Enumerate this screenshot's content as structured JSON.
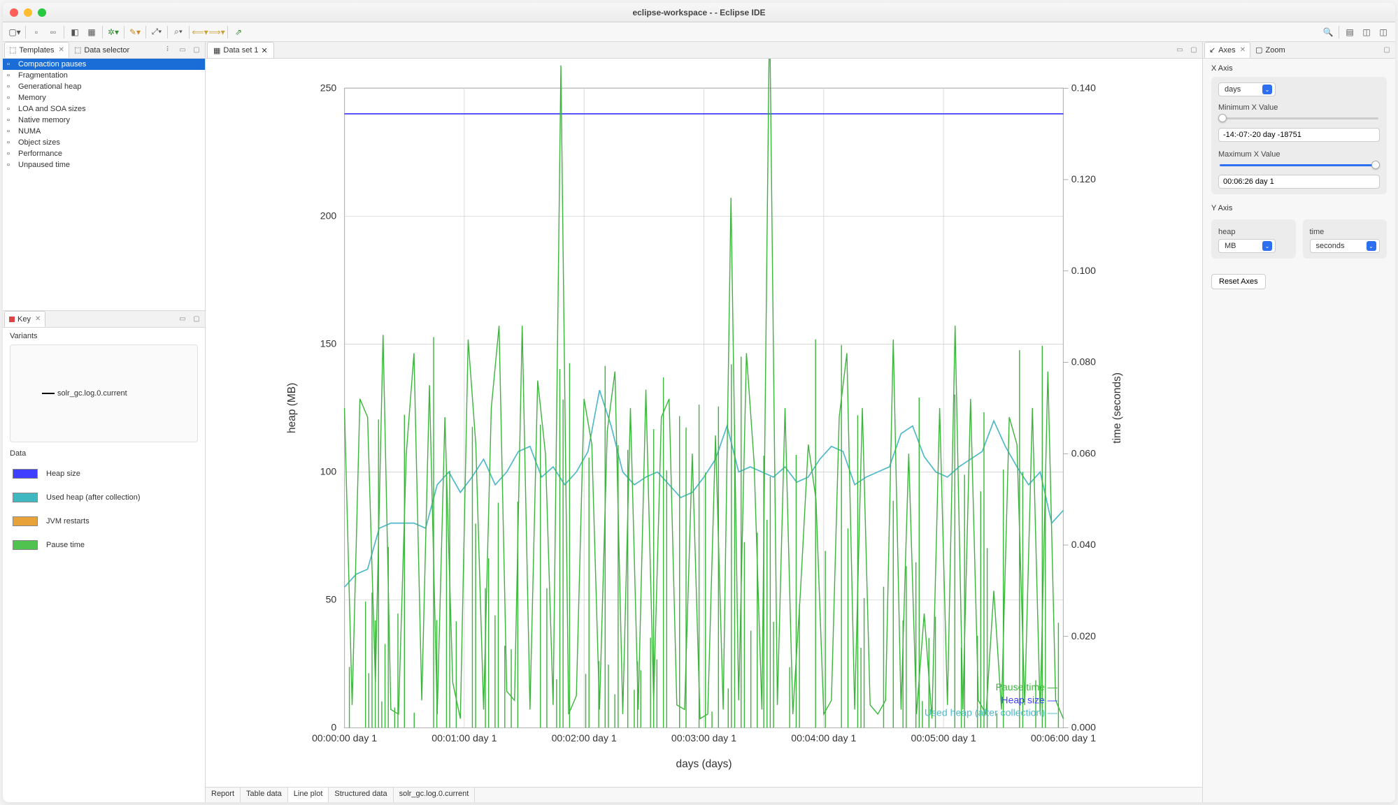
{
  "window": {
    "title": "eclipse-workspace -  - Eclipse IDE"
  },
  "left": {
    "tabs": {
      "templates": "Templates",
      "data_selector": "Data selector"
    },
    "tree_items": [
      "Compaction pauses",
      "Fragmentation",
      "Generational heap",
      "Memory",
      "LOA and SOA sizes",
      "Native memory",
      "NUMA",
      "Object sizes",
      "Performance",
      "Unpaused time"
    ],
    "key_tab": "Key",
    "variants_label": "Variants",
    "variants_item": "solr_gc.log.0.current",
    "data_label": "Data",
    "data_items": [
      {
        "label": "Heap size",
        "color": "#3f3fff"
      },
      {
        "label": "Used heap (after collection)",
        "color": "#3fb8bf"
      },
      {
        "label": "JVM restarts",
        "color": "#e8a23a"
      },
      {
        "label": "Pause time",
        "color": "#4fc24f"
      }
    ]
  },
  "center": {
    "editor_tab": "Data set 1",
    "bottom_tabs": [
      "Report",
      "Table data",
      "Line plot",
      "Structured data",
      "solr_gc.log.0.current"
    ],
    "active_bottom": 2
  },
  "right": {
    "tabs": {
      "axes": "Axes",
      "zoom": "Zoom"
    },
    "x_axis_label": "X Axis",
    "x_unit": "days",
    "min_x_label": "Minimum X Value",
    "min_x_value": "-14:-07:-20 day -18751",
    "max_x_label": "Maximum X Value",
    "max_x_value": "00:06:26 day 1",
    "y_axis_label": "Y Axis",
    "y_heap_label": "heap",
    "y_heap_unit": "MB",
    "y_time_label": "time",
    "y_time_unit": "seconds",
    "reset_btn": "Reset Axes"
  },
  "chart_data": {
    "type": "line",
    "xlabel": "days (days)",
    "ylabel_left": "heap (MB)",
    "ylabel_right": "time (seconds)",
    "x_ticks": [
      "00:00:00 day 1",
      "00:01:00 day 1",
      "00:02:00 day 1",
      "00:03:00 day 1",
      "00:04:00 day 1",
      "00:05:00 day 1",
      "00:06:00 day 1"
    ],
    "y_left_ticks": [
      0,
      50,
      100,
      150,
      200,
      250
    ],
    "y_right_ticks": [
      0.0,
      0.02,
      0.04,
      0.06,
      0.08,
      0.1,
      0.12,
      0.14
    ],
    "heap_size_mb": 240,
    "legend": [
      "Pause time",
      "Heap size",
      "Used heap (after collection)"
    ],
    "series": [
      {
        "name": "Used heap (after collection)",
        "color": "#4fb8c9",
        "axis": "left",
        "y": [
          55,
          60,
          62,
          78,
          80,
          80,
          80,
          78,
          95,
          100,
          92,
          98,
          105,
          95,
          100,
          108,
          110,
          98,
          102,
          95,
          100,
          108,
          132,
          118,
          100,
          95,
          98,
          100,
          95,
          90,
          92,
          98,
          105,
          118,
          100,
          102,
          100,
          98,
          102,
          96,
          98,
          105,
          110,
          108,
          95,
          98,
          100,
          102,
          115,
          118,
          106,
          100,
          98,
          102,
          105,
          108,
          120,
          110,
          102,
          95,
          100,
          80,
          85
        ]
      },
      {
        "name": "Pause time",
        "color": "#3bb53b",
        "axis": "right",
        "y": [
          0.07,
          0.005,
          0.072,
          0.068,
          0.01,
          0.086,
          0.004,
          0.003,
          0.06,
          0.082,
          0.006,
          0.075,
          0.003,
          0.068,
          0.01,
          0.002,
          0.085,
          0.062,
          0.004,
          0.07,
          0.088,
          0.008,
          0.006,
          0.088,
          0.004,
          0.076,
          0.06,
          0.005,
          0.145,
          0.003,
          0.007,
          0.072,
          0.062,
          0.004,
          0.065,
          0.078,
          0.003,
          0.07,
          0.004,
          0.074,
          0.006,
          0.068,
          0.072,
          0.005,
          0.004,
          0.06,
          0.002,
          0.003,
          0.064,
          0.004,
          0.116,
          0.006,
          0.082,
          0.058,
          0.004,
          0.158,
          0.005,
          0.07,
          0.003,
          0.03,
          0.062,
          0.05,
          0.003,
          0.006,
          0.068,
          0.082,
          0.004,
          0.07,
          0.005,
          0.003,
          0.006,
          0.085,
          0.004,
          0.06,
          0.003,
          0.025,
          0.002,
          0.07,
          0.005,
          0.088,
          0.004,
          0.072,
          0.006,
          0.003,
          0.03,
          0.004,
          0.068,
          0.062,
          0.005,
          0.07,
          0.003,
          0.078,
          0.006,
          0.002
        ]
      }
    ]
  }
}
